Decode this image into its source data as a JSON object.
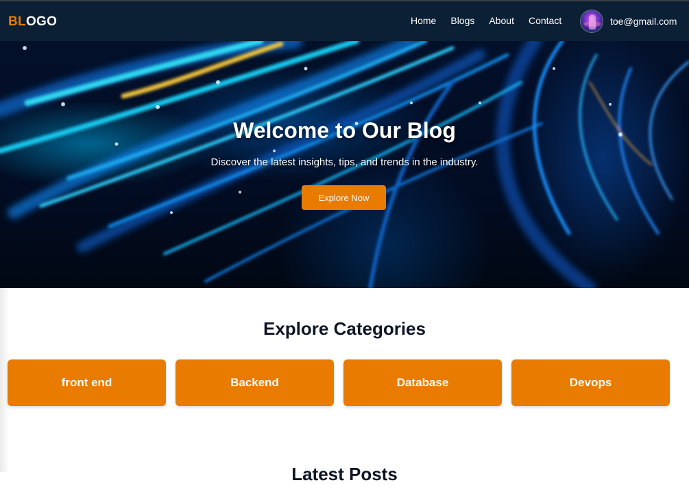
{
  "navbar": {
    "logo_accent": "BL",
    "logo_rest": "OGO",
    "links": [
      "Home",
      "Blogs",
      "About",
      "Contact"
    ],
    "user_email": "toe@gmail.com"
  },
  "hero": {
    "title": "Welcome to Our Blog",
    "subtitle": "Discover the latest insights, tips, and trends in the industry.",
    "cta_label": "Explore Now"
  },
  "categories": {
    "title": "Explore Categories",
    "items": [
      "front end",
      "Backend",
      "Database",
      "Devops"
    ]
  },
  "next_section": {
    "title": "Latest Posts"
  },
  "colors": {
    "accent": "#e87b00",
    "navbar_bg": "#0b1f35",
    "heading": "#0e1524"
  }
}
